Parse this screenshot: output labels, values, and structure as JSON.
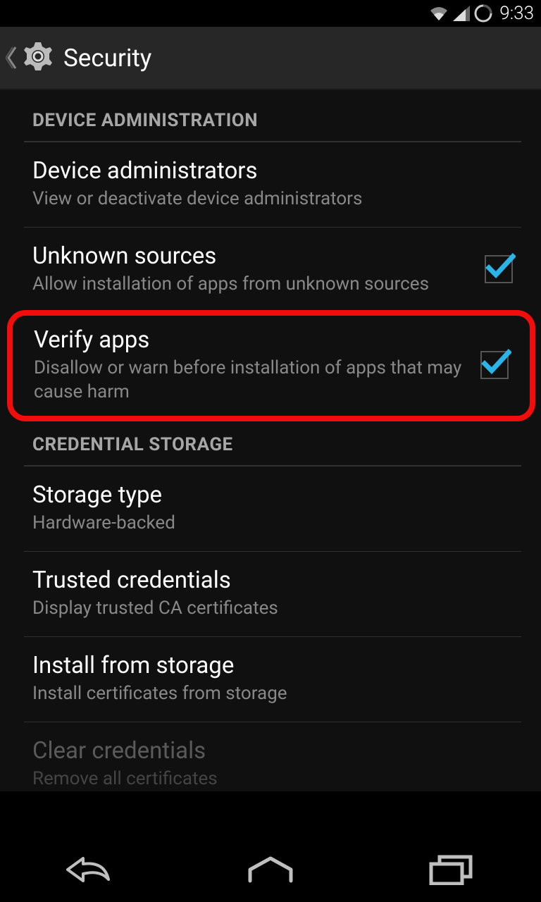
{
  "status_bar": {
    "time": "9:33"
  },
  "header": {
    "title": "Security"
  },
  "sections": {
    "device_admin": {
      "label": "DEVICE ADMINISTRATION",
      "items": {
        "device_admins": {
          "title": "Device administrators",
          "subtitle": "View or deactivate device administrators"
        },
        "unknown_sources": {
          "title": "Unknown sources",
          "subtitle": "Allow installation of apps from unknown sources"
        },
        "verify_apps": {
          "title": "Verify apps",
          "subtitle": "Disallow or warn before installation of apps that may cause harm"
        }
      }
    },
    "credential_storage": {
      "label": "CREDENTIAL STORAGE",
      "items": {
        "storage_type": {
          "title": "Storage type",
          "subtitle": "Hardware-backed"
        },
        "trusted_credentials": {
          "title": "Trusted credentials",
          "subtitle": "Display trusted CA certificates"
        },
        "install_from_storage": {
          "title": "Install from storage",
          "subtitle": "Install certificates from storage"
        },
        "clear_credentials": {
          "title": "Clear credentials",
          "subtitle": "Remove all certificates"
        }
      }
    }
  }
}
